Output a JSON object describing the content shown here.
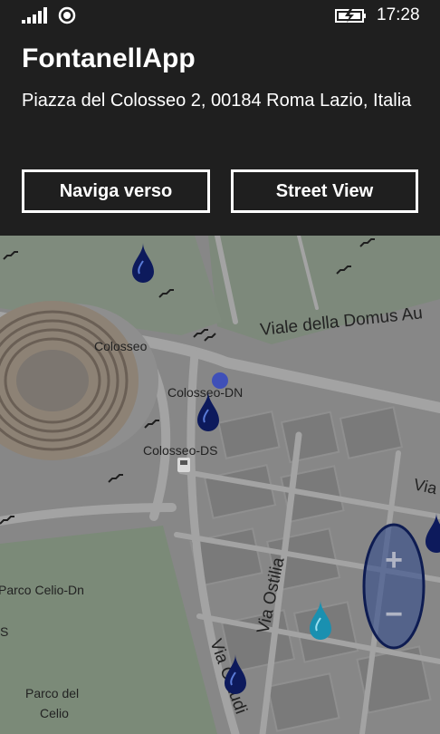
{
  "status": {
    "time": "17:28"
  },
  "app": {
    "title": "FontanellApp",
    "address": "Piazza del Colosseo 2, 00184 Roma Lazio, Italia"
  },
  "actions": {
    "navigate": "Naviga verso",
    "street_view": "Street View"
  },
  "map": {
    "labels": {
      "viale": "Viale della Domus Au",
      "colosseo": "Colosseo",
      "colosseo_dn": "Colosseo-DN",
      "colosseo_ds": "Colosseo-DS",
      "via_right": "Via",
      "parco_celio_dn": "Parco Celio-Dn",
      "s_edge": "S",
      "via_ostilia": "Via Ostilia",
      "parco_line1": "Parco del",
      "parco_line2": "Celio",
      "via_claudia": "Via Claudi"
    }
  },
  "zoom": {
    "plus": "+",
    "minus": "−"
  }
}
